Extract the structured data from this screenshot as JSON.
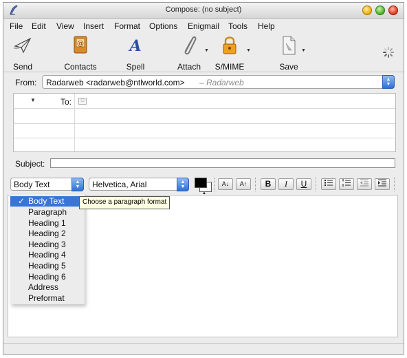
{
  "window": {
    "title": "Compose: (no subject)"
  },
  "menu": [
    "File",
    "Edit",
    "View",
    "Insert",
    "Format",
    "Options",
    "Enigmail",
    "Tools",
    "Help"
  ],
  "toolbar": {
    "send": "Send",
    "contacts": "Contacts",
    "spell": "Spell",
    "attach": "Attach",
    "smime": "S/MIME",
    "save": "Save"
  },
  "from": {
    "label": "From:",
    "value": "Radarweb <radarweb@ntlworld.com>",
    "identity": "– Radarweb"
  },
  "addressing": {
    "to_label": "To:"
  },
  "subject": {
    "label": "Subject:",
    "value": ""
  },
  "format": {
    "paragraph_format": "Body Text",
    "font": "Helvetica, Arial",
    "smaller_label": "A↓",
    "larger_label": "A↑",
    "bold_label": "B",
    "italic_label": "I",
    "underline_label": "U",
    "text_color": "#000000",
    "background_color": "#ffffff"
  },
  "dropdown": {
    "items": [
      "Body Text",
      "Paragraph",
      "Heading 1",
      "Heading 2",
      "Heading 3",
      "Heading 4",
      "Heading 5",
      "Heading 6",
      "Address",
      "Preformat"
    ],
    "selected_index": 0,
    "checkmark": "✓"
  },
  "tooltip": "Choose a paragraph format"
}
